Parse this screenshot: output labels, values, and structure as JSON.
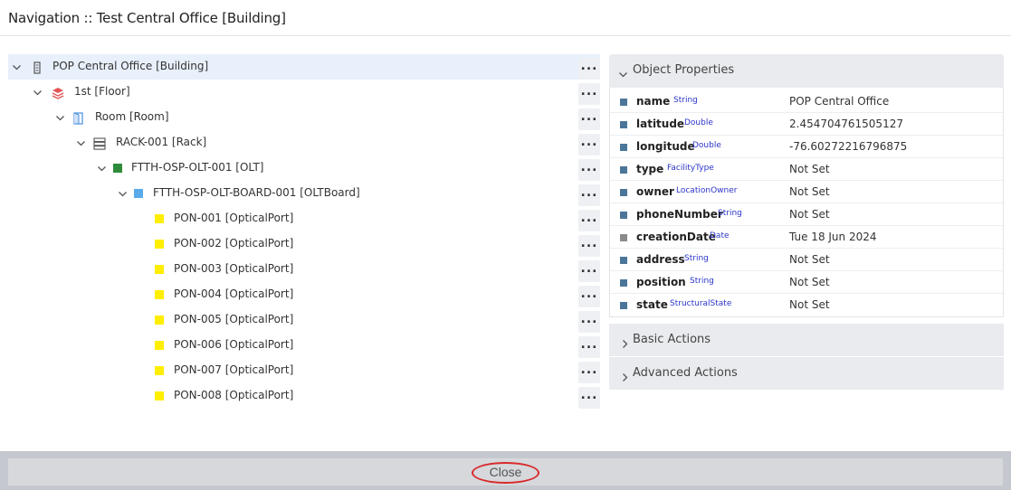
{
  "header": {
    "title": "Navigation :: Test Central Office [Building]"
  },
  "tree": {
    "more_label": "...",
    "nodes": [
      {
        "label": "POP Central Office [Building]",
        "icon": "building-icon"
      },
      {
        "label": "1st [Floor]",
        "icon": "floor-icon"
      },
      {
        "label": "Room [Room]",
        "icon": "room-icon"
      },
      {
        "label": "RACK-001 [Rack]",
        "icon": "rack-icon"
      },
      {
        "label": "FTTH-OSP-OLT-001 [OLT]",
        "icon": "olt-icon",
        "color": "#2e8b3a"
      },
      {
        "label": "FTTH-OSP-OLT-BOARD-001 [OLTBoard]",
        "icon": "olt-board-icon",
        "color": "#5aabec"
      },
      {
        "label": "PON-001 [OpticalPort]",
        "icon": "optical-port-icon",
        "color": "#ffee00"
      },
      {
        "label": "PON-002 [OpticalPort]",
        "icon": "optical-port-icon",
        "color": "#ffee00"
      },
      {
        "label": "PON-003 [OpticalPort]",
        "icon": "optical-port-icon",
        "color": "#ffee00"
      },
      {
        "label": "PON-004 [OpticalPort]",
        "icon": "optical-port-icon",
        "color": "#ffee00"
      },
      {
        "label": "PON-005 [OpticalPort]",
        "icon": "optical-port-icon",
        "color": "#ffee00"
      },
      {
        "label": "PON-006 [OpticalPort]",
        "icon": "optical-port-icon",
        "color": "#ffee00"
      },
      {
        "label": "PON-007 [OpticalPort]",
        "icon": "optical-port-icon",
        "color": "#ffee00"
      },
      {
        "label": "PON-008 [OpticalPort]",
        "icon": "optical-port-icon",
        "color": "#ffee00"
      }
    ]
  },
  "object_properties": {
    "title": "Object Properties",
    "rows": [
      {
        "name": "name",
        "type": "String",
        "value": "POP Central Office"
      },
      {
        "name": "latitude",
        "type": "Double",
        "value": "2.454704761505127"
      },
      {
        "name": "longitude",
        "type": "Double",
        "value": "-76.60272216796875"
      },
      {
        "name": "type",
        "type": "FacilityType",
        "value": "Not Set"
      },
      {
        "name": "owner",
        "type": "LocationOwner",
        "value": "Not Set"
      },
      {
        "name": "phoneNumber",
        "type": "String",
        "value": "Not Set"
      },
      {
        "name": "creationDate",
        "type": "Date",
        "value": "Tue 18 Jun 2024"
      },
      {
        "name": "address",
        "type": "String",
        "value": "Not Set"
      },
      {
        "name": "position",
        "type": "String",
        "value": "Not Set"
      },
      {
        "name": "state",
        "type": "StructuralState",
        "value": "Not Set"
      }
    ]
  },
  "basic_actions": {
    "title": "Basic Actions"
  },
  "advanced_actions": {
    "title": "Advanced Actions"
  },
  "footer": {
    "close_label": "Close"
  },
  "colors": {
    "selected_row": "#e8f0fb",
    "type_text": "#2a34c9",
    "highlight_ring": "#d92a2a"
  }
}
